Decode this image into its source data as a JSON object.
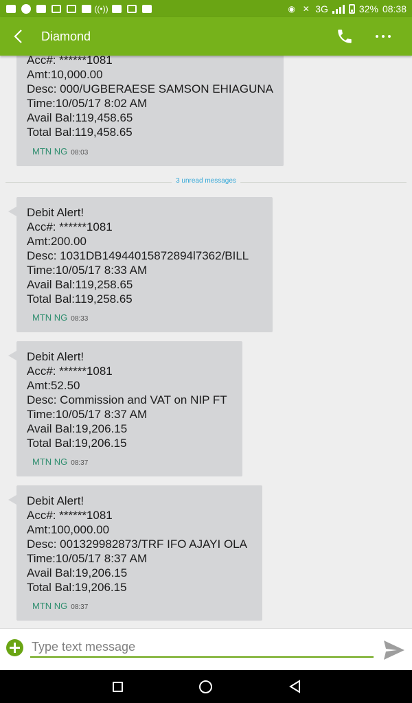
{
  "status_bar": {
    "left_icons": [
      "mail-icon",
      "whatsapp-icon",
      "chat-icon",
      "image-icon",
      "gmail-icon",
      "app-icon",
      "broadcast-icon",
      "app-alert-icon",
      "lock-icon",
      "upload-icon"
    ],
    "network": "3G",
    "battery": "32%",
    "time": "08:38"
  },
  "app_bar": {
    "title": "Diamond",
    "color": "#76b21b"
  },
  "messages": [
    {
      "lines": [
        "Acc#: ******1081",
        "Amt:10,000.00",
        "Desc: 000/UGBERAESE  SAMSON EHIAGUNA",
        "Time:10/05/17 8:02 AM",
        "Avail Bal:119,458.65",
        "Total Bal:119,458.65"
      ],
      "sender": "MTN NG",
      "time": "08:03"
    },
    {
      "lines": [
        "Debit Alert!",
        "Acc#: ******1081",
        "Amt:200.00",
        "Desc: 1031DB14944015872894l7362/BILL",
        "Time:10/05/17 8:33 AM",
        "Avail Bal:119,258.65",
        "Total Bal:119,258.65"
      ],
      "sender": "MTN NG",
      "time": "08:33"
    },
    {
      "lines": [
        "Debit Alert!",
        "Acc#: ******1081",
        "Amt:52.50",
        "Desc: Commission and VAT on NIP FT",
        "Time:10/05/17 8:37 AM",
        "Avail Bal:19,206.15",
        "Total Bal:19,206.15"
      ],
      "sender": "MTN NG",
      "time": "08:37"
    },
    {
      "lines": [
        "Debit Alert!",
        "Acc#: ******1081",
        "Amt:100,000.00",
        "Desc: 001329982873/TRF IFO AJAYI OLA",
        "Time:10/05/17 8:37 AM",
        "Avail Bal:19,206.15",
        "Total Bal:19,206.15"
      ],
      "sender": "MTN NG",
      "time": "08:37"
    }
  ],
  "unread_divider": "3 unread messages",
  "composer": {
    "placeholder": "Type text message"
  }
}
